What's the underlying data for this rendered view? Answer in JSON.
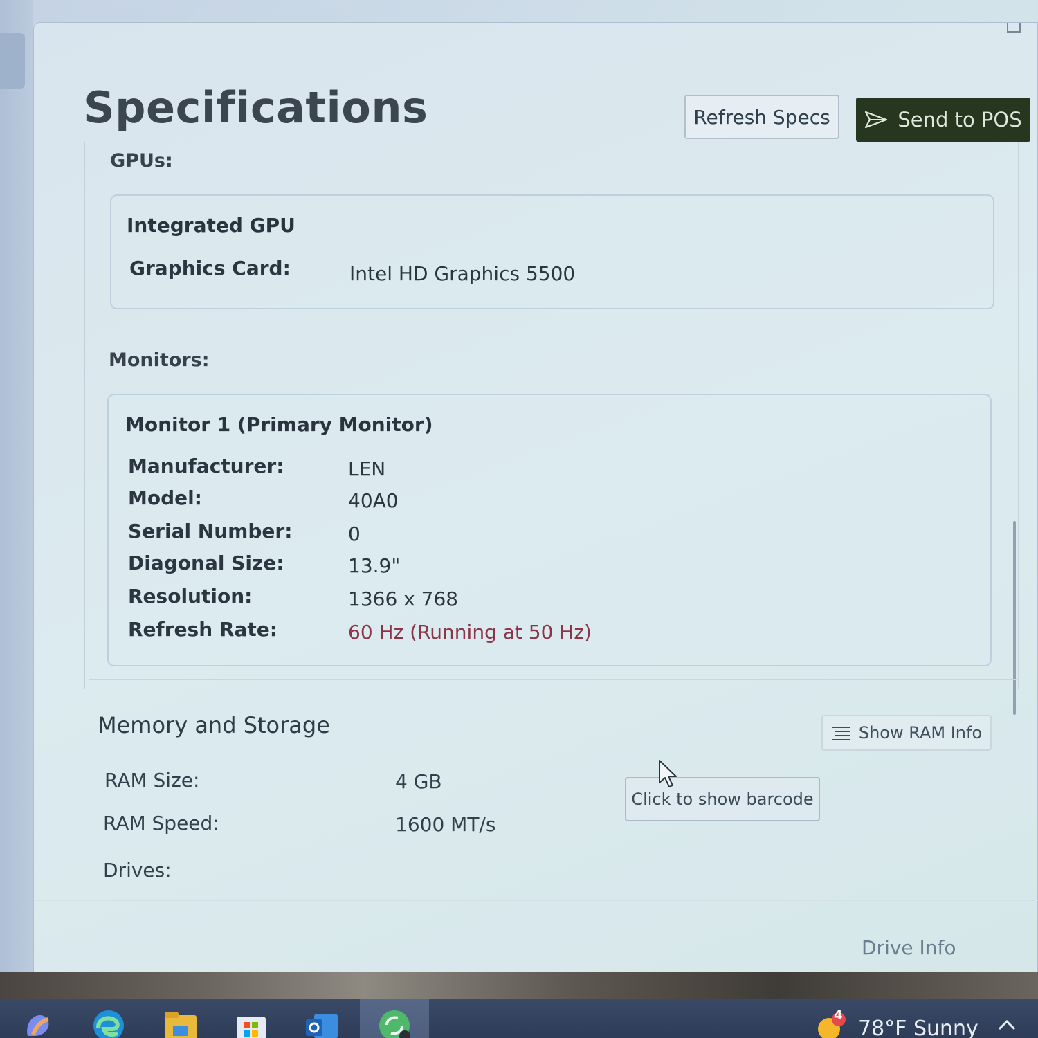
{
  "header": {
    "title": "Specifications",
    "refresh_label": "Refresh Specs",
    "send_label": "Send to POS"
  },
  "gpus": {
    "section_label": "GPUs:",
    "items": [
      {
        "title": "Integrated GPU",
        "card_label": "Graphics Card:",
        "card_value": "Intel HD Graphics 5500"
      }
    ]
  },
  "monitors": {
    "section_label": "Monitors:",
    "items": [
      {
        "title": "Monitor 1 (Primary Monitor)",
        "fields": [
          {
            "label": "Manufacturer:",
            "value": "LEN"
          },
          {
            "label": "Model:",
            "value": "40A0"
          },
          {
            "label": "Serial Number:",
            "value": "0"
          },
          {
            "label": "Diagonal Size:",
            "value": "13.9\""
          },
          {
            "label": "Resolution:",
            "value": "1366 x 768"
          },
          {
            "label": "Refresh Rate:",
            "value": "60 Hz (Running at 50 Hz)"
          }
        ]
      }
    ]
  },
  "memory": {
    "title": "Memory and Storage",
    "show_ram_label": "Show RAM Info",
    "barcode_label": "Click to show barcode",
    "ram_size_label": "RAM Size:",
    "ram_size_value": "4 GB",
    "ram_speed_label": "RAM Speed:",
    "ram_speed_value": "1600 MT/s",
    "drives_label": "Drives:",
    "drive_info_label": "Drive Info"
  },
  "taskbar": {
    "weather_badge": "4",
    "weather_text": "78°F  Sunny"
  },
  "colors": {
    "accent_dark": "#27361f",
    "warning_text": "#8a3548"
  }
}
